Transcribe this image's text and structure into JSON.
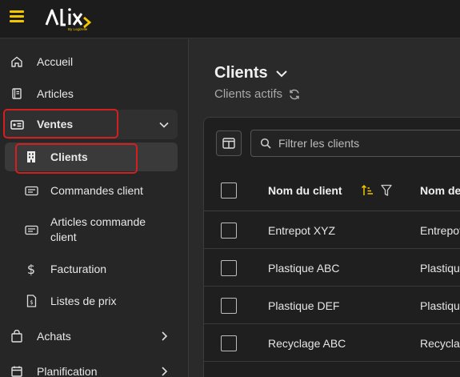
{
  "app": {
    "logo_text": "ALIX",
    "logo_tagline": "By Logizelle",
    "accent": "#f3c600",
    "highlight": "#d21f1f"
  },
  "sidebar": {
    "items": [
      {
        "label": "Accueil",
        "icon": "home-icon"
      },
      {
        "label": "Articles",
        "icon": "book-icon"
      },
      {
        "label": "Ventes",
        "icon": "id-card-icon",
        "expanded": true
      },
      {
        "label": "Clients",
        "icon": "building-icon",
        "active": true
      },
      {
        "label": "Commandes client",
        "icon": "card-icon"
      },
      {
        "label": "Articles commande client",
        "icon": "card-icon"
      },
      {
        "label": "Facturation",
        "icon": "dollar-icon"
      },
      {
        "label": "Listes de prix",
        "icon": "price-file-icon"
      },
      {
        "label": "Achats",
        "icon": "bag-icon"
      },
      {
        "label": "Planification",
        "icon": "calendar-icon"
      }
    ]
  },
  "main": {
    "title": "Clients",
    "subtitle": "Clients actifs",
    "filter_placeholder": "Filtrer les clients",
    "filter_value": ""
  },
  "table": {
    "columns": [
      "Nom du client",
      "Nom de"
    ],
    "rows": [
      [
        "Entrepot XYZ",
        "Entrepot"
      ],
      [
        "Plastique ABC",
        "Plastiqu"
      ],
      [
        "Plastique DEF",
        "Plastiqu"
      ],
      [
        "Recyclage ABC",
        "Recyclag"
      ]
    ]
  }
}
